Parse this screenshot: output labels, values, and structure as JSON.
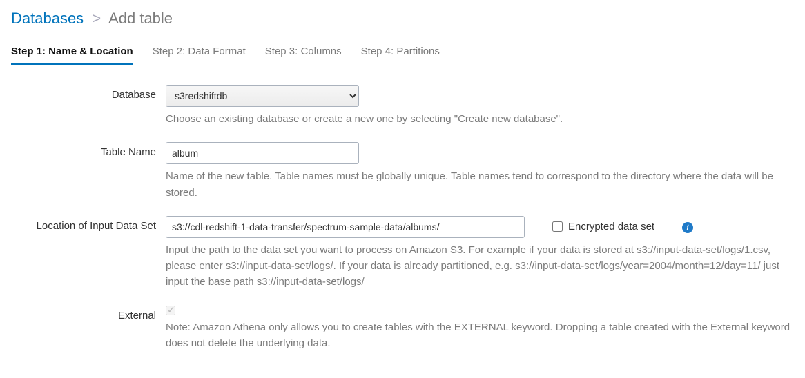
{
  "breadcrumb": {
    "root": "Databases",
    "current": "Add table"
  },
  "tabs": [
    {
      "label": "Step 1: Name & Location",
      "active": true
    },
    {
      "label": "Step 2: Data Format",
      "active": false
    },
    {
      "label": "Step 3: Columns",
      "active": false
    },
    {
      "label": "Step 4: Partitions",
      "active": false
    }
  ],
  "database": {
    "label": "Database",
    "value": "s3redshiftdb",
    "hint": "Choose an existing database or create a new one by selecting \"Create new database\"."
  },
  "tableName": {
    "label": "Table Name",
    "value": "album",
    "hint": "Name of the new table. Table names must be globally unique. Table names tend to correspond to the directory where the data will be stored."
  },
  "location": {
    "label": "Location of Input Data Set",
    "value": "s3://cdl-redshift-1-data-transfer/spectrum-sample-data/albums/",
    "encryptedLabel": "Encrypted data set",
    "encrypted": false,
    "hint": "Input the path to the data set you want to process on Amazon S3. For example if your data is stored at s3://input-data-set/logs/1.csv, please enter s3://input-data-set/logs/. If your data is already partitioned, e.g. s3://input-data-set/logs/year=2004/month=12/day=11/ just input the base path s3://input-data-set/logs/"
  },
  "external": {
    "label": "External",
    "checked": true,
    "disabled": true,
    "hint": "Note: Amazon Athena only allows you to create tables with the EXTERNAL keyword. Dropping a table created with the External keyword does not delete the underlying data."
  }
}
